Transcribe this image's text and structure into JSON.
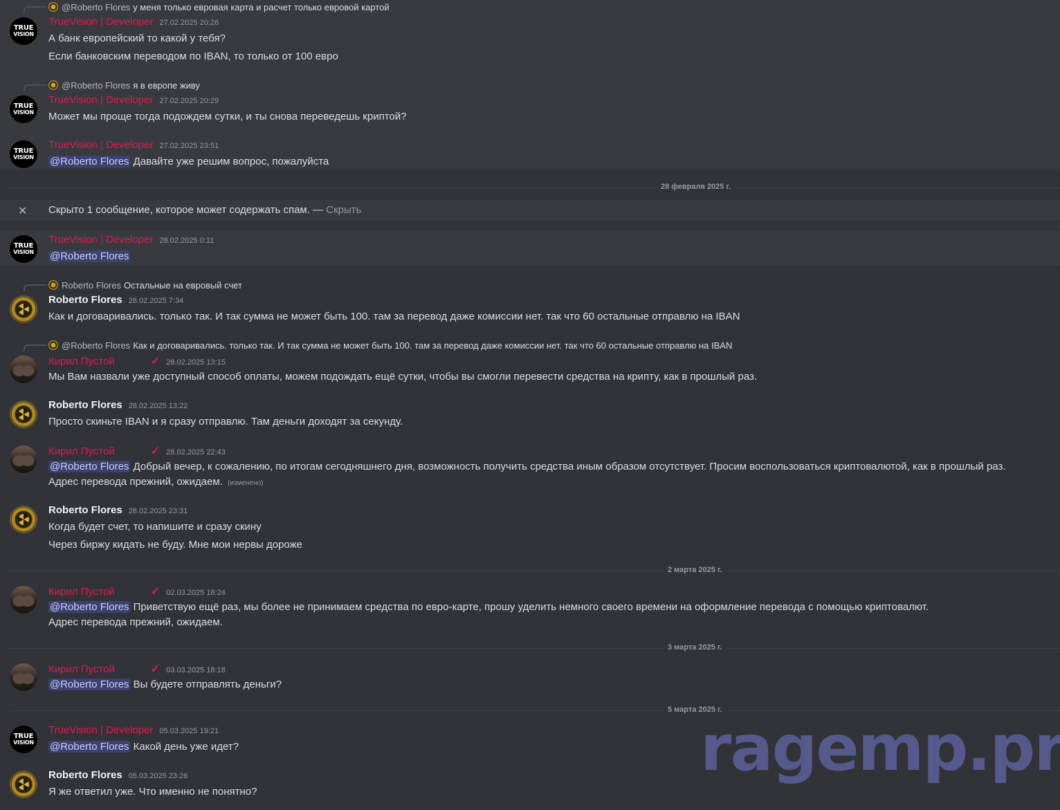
{
  "messages": {
    "m1": {
      "reply_name": "@Roberto Flores",
      "reply_text": "у меня только евровая карта и расчет только евровой картой",
      "author": "TrueVision | Developer",
      "time": "27.02.2025 20:26",
      "lines": [
        "А банк европейский то какой у тебя?",
        "Если банковским переводом по IBAN, то только от 100 евро"
      ]
    },
    "m2": {
      "reply_name": "@Roberto Flores",
      "reply_text": "я в европе живу",
      "author": "TrueVision | Developer",
      "time": "27.02.2025 20:29",
      "lines": [
        "Может мы проще тогда подождем сутки, и ты снова переведешь криптой?"
      ]
    },
    "m3": {
      "author": "TrueVision | Developer",
      "time": "27.02.2025 23:51",
      "mention": "@Roberto Flores",
      "text": "Давайте уже решим вопрос, пожалуйста"
    },
    "spam": {
      "text": "Скрыто 1 сообщение, которое может содержать спам. —",
      "link": "Скрыть"
    },
    "m4": {
      "author": "TrueVision | Developer",
      "time": "28.02.2025 0:11",
      "mention": "@Roberto Flores"
    },
    "m5": {
      "reply_name": "Roberto Flores",
      "reply_text": "Остальные на евровый счет",
      "author": "Roberto Flores",
      "time": "28.02.2025 7:34",
      "text": "Как и договаривались. только так. И так сумма не может быть 100. там за перевод даже комиссии нет. так что 60 остальные отправлю на IBAN"
    },
    "m6": {
      "reply_name": "@Roberto Flores",
      "reply_text": "Как и договаривались. только так. И так сумма не может быть 100. там за перевод даже комиссии нет. так что 60 остальные отправлю на IBAN",
      "author": "Кирил Пустой",
      "check": "✓",
      "time": "28.02.2025 13:15",
      "text": "Мы Вам назвали уже доступный способ оплаты, можем подождать ещё сутки, чтобы вы смогли перевести средства на крипту, как в прошлый раз."
    },
    "m7": {
      "author": "Roberto Flores",
      "time": "28.02.2025 13:22",
      "text": "Просто скиньте IBAN и я сразу отправлю. Там деньги доходят за секунду."
    },
    "m8": {
      "author": "Кирил Пустой",
      "check": "✓",
      "time": "28.02.2025 22:43",
      "mention": "@Roberto Flores",
      "text": "Добрый вечер, к сожалению, по итогам сегодняшнего дня, возможность получить средства иным образом отсутствует. Просим воспользоваться криптовалютой, как в прошлый раз.",
      "text2": "Адрес перевода прежний, ожидаем.",
      "edited": "(изменено)"
    },
    "m9": {
      "author": "Roberto Flores",
      "time": "28.02.2025 23:31",
      "lines": [
        "Когда будет счет, то напишите и сразу скину",
        "Через биржу кидать не буду. Мне мои нервы дороже"
      ]
    },
    "m10": {
      "author": "Кирил Пустой",
      "check": "✓",
      "time": "02.03.2025 18:24",
      "mention": "@Roberto Flores",
      "text": "Приветствую ещё раз, мы более не принимаем средства по евро-карте, прошу уделить немного своего времени на оформление перевода с помощью криптовалют.",
      "text2": "Адрес перевода прежний, ожидаем."
    },
    "m11": {
      "author": "Кирил Пустой",
      "check": "✓",
      "time": "03.03.2025 18:18",
      "mention": "@Roberto Flores",
      "text": "Вы будете отправлять деньги?"
    },
    "m12": {
      "author": "TrueVision | Developer",
      "time": "05.03.2025 19:21",
      "mention": "@Roberto Flores",
      "text": "Какой день уже идет?"
    },
    "m13": {
      "author": "Roberto Flores",
      "time": "05.03.2025 23:26",
      "text": "Я же ответил уже. Что именно не понятно?"
    }
  },
  "dividers": {
    "d1": "28 февраля 2025 г.",
    "d2": "2 марта 2025 г.",
    "d3": "3 марта 2025 г.",
    "d4": "5 марта 2025 г."
  },
  "avatar_text": {
    "l1": "TRUE",
    "l2": "VISION"
  },
  "watermark": "ragemp.pro",
  "colors": {
    "background": "#323339",
    "highlight": "#383a40",
    "accent_red": "#e01a4f",
    "mention_bg": "#3c4270"
  }
}
